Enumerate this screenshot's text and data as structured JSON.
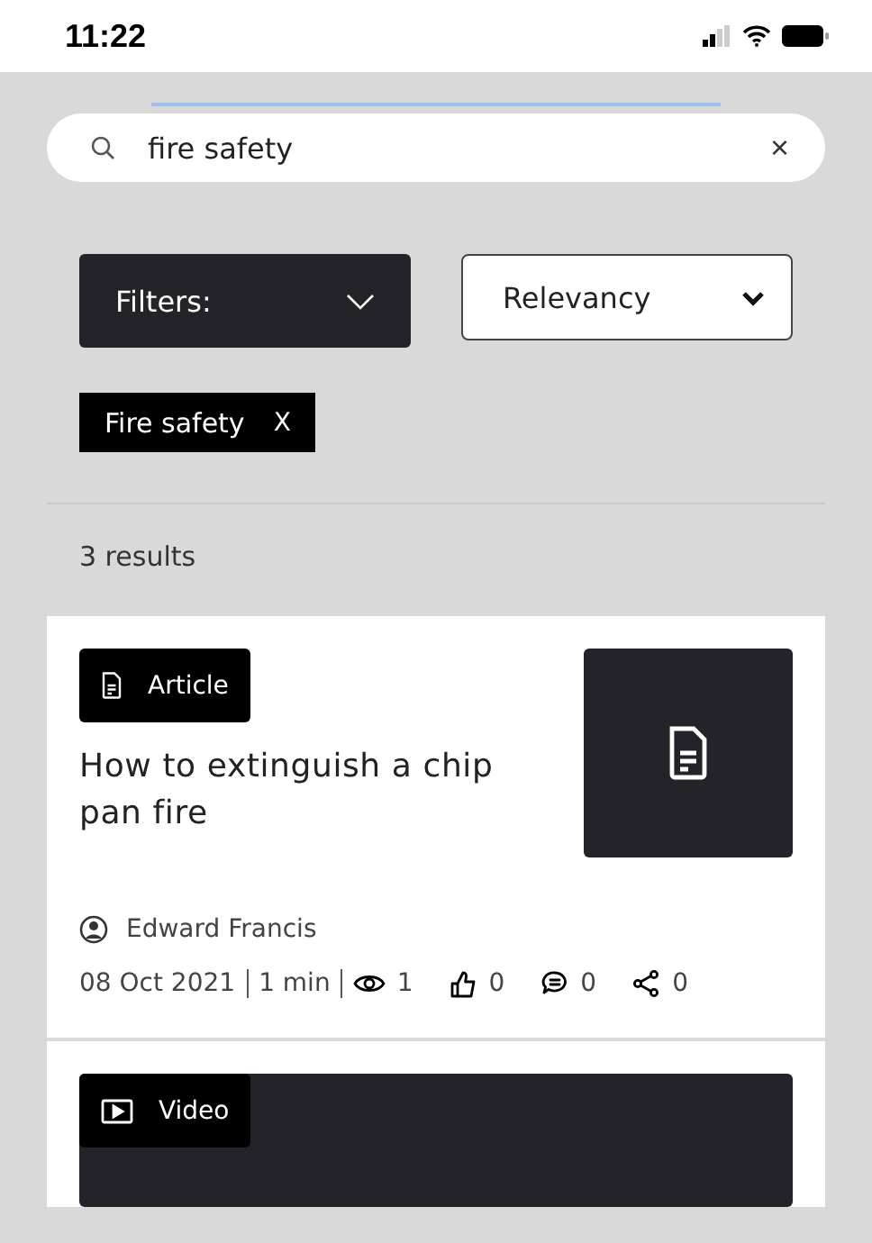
{
  "status_bar": {
    "time": "11:22"
  },
  "search": {
    "value": "fire safety",
    "clear": "×"
  },
  "filter_button": {
    "label": "Filters:"
  },
  "sort_select": {
    "value": "Relevancy"
  },
  "chips": [
    {
      "label": "Fire safety",
      "remove": "X"
    }
  ],
  "results_count": "3 results",
  "cards": [
    {
      "kind": "article",
      "type_label": "Article",
      "title": "How to extinguish a chip pan fire",
      "author": "Edward Francis",
      "date": "08 Oct 2021",
      "duration": "1 min",
      "views": "1",
      "likes": "0",
      "comments": "0",
      "shares": "0"
    },
    {
      "kind": "video",
      "type_label": "Video"
    }
  ]
}
